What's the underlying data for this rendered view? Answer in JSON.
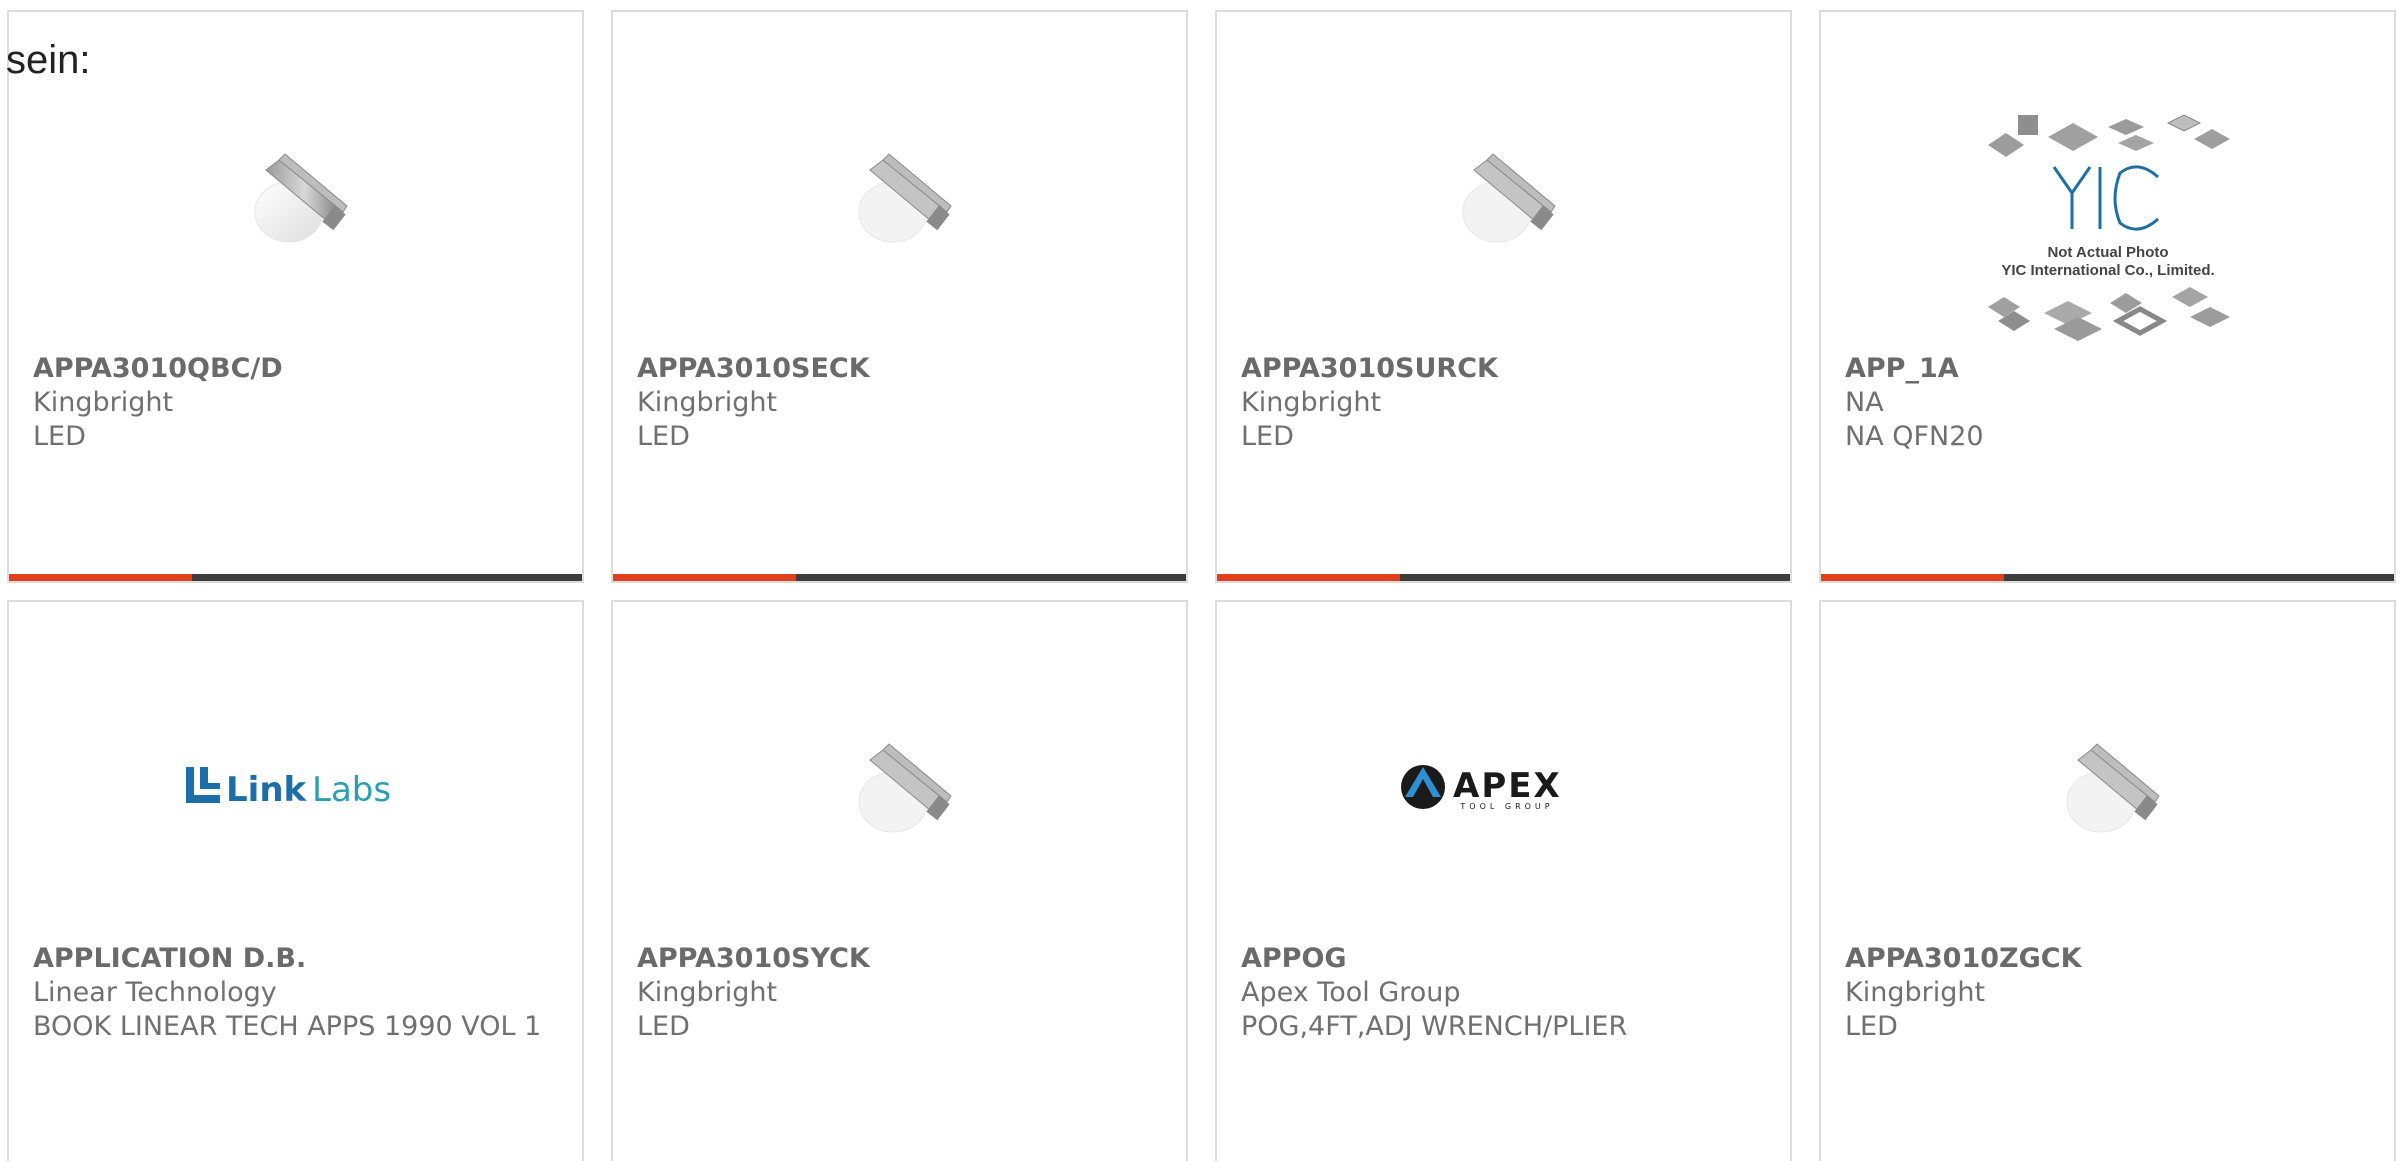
{
  "header_fragment": "sein:",
  "colors": {
    "card_border": "#dcdcdc",
    "accent_bar": "#e0401b",
    "bar_dark": "#3d3d3d",
    "text_gray": "#707070",
    "linklabs_blue": "#1c6ea8",
    "linklabs_teal": "#2a9fb0"
  },
  "products": [
    {
      "part_number": "APPA3010QBC/D",
      "manufacturer": "Kingbright",
      "description": "LED",
      "image": "led-smd-image"
    },
    {
      "part_number": "APPA3010SECK",
      "manufacturer": "Kingbright",
      "description": "LED",
      "image": "led-smd-image"
    },
    {
      "part_number": "APPA3010SURCK",
      "manufacturer": "Kingbright",
      "description": "LED",
      "image": "led-smd-image"
    },
    {
      "part_number": "APP_1A",
      "manufacturer": "NA",
      "description": "NA QFN20",
      "image": "yic-placeholder-image",
      "image_text": {
        "logo": "YIC",
        "line1": "Not Actual Photo",
        "line2": "YIC International Co., Limited."
      }
    },
    {
      "part_number": "APPLICATION D.B.",
      "manufacturer": "Linear Technology",
      "description": "BOOK LINEAR TECH APPS 1990 VOL 1",
      "image": "linklabs-logo",
      "image_text": {
        "logo": "LinkLabs"
      }
    },
    {
      "part_number": "APPA3010SYCK",
      "manufacturer": "Kingbright",
      "description": "LED",
      "image": "led-smd-image"
    },
    {
      "part_number": "APPOG",
      "manufacturer": "Apex Tool Group",
      "description": "POG,4FT,ADJ WRENCH/PLIER",
      "image": "apex-logo",
      "image_text": {
        "logo": "APEX",
        "sub": "TOOL GROUP"
      }
    },
    {
      "part_number": "APPA3010ZGCK",
      "manufacturer": "Kingbright",
      "description": "LED",
      "image": "led-smd-image"
    }
  ]
}
